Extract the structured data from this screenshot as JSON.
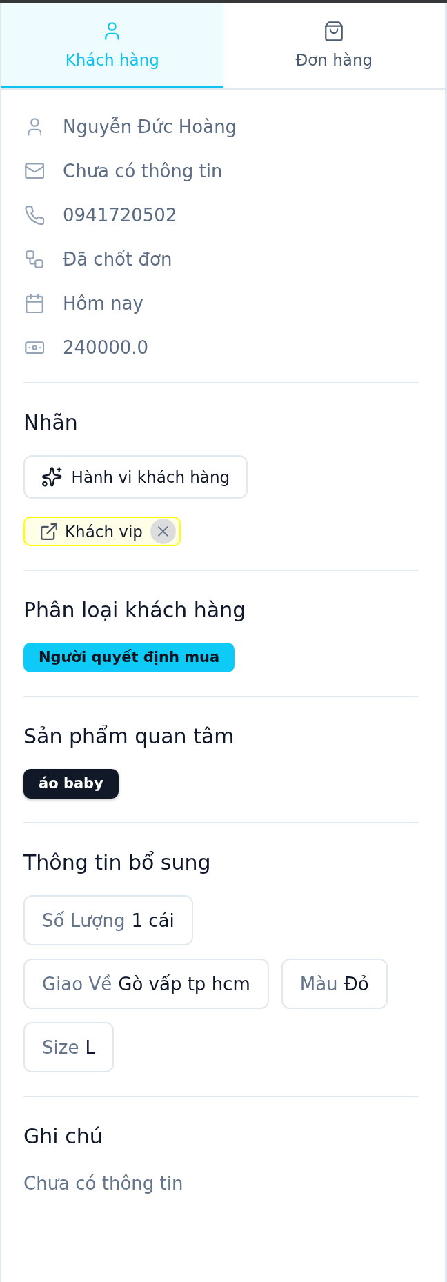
{
  "tabs": [
    {
      "kind": "customer",
      "label": "Khách hàng",
      "selected": true
    },
    {
      "kind": "order",
      "label": "Đơn hàng",
      "selected": false
    }
  ],
  "customer_info": [
    {
      "kind": "name",
      "value": "Nguyễn Đức Hoàng"
    },
    {
      "kind": "email",
      "value": "Chưa có thông tin"
    },
    {
      "kind": "phone",
      "value": "0941720502"
    },
    {
      "kind": "status",
      "value": "Đã chốt đơn"
    },
    {
      "kind": "date",
      "value": "Hôm nay"
    },
    {
      "kind": "amount",
      "value": "240000.0"
    }
  ],
  "labels": {
    "title": "Nhãn",
    "action_button": "Hành vi khách hàng",
    "tags": [
      {
        "text": "Khách vip",
        "color": "#ffff00"
      }
    ]
  },
  "classification": {
    "title": "Phân loại khách hàng",
    "badges": [
      "Người quyết định mua"
    ]
  },
  "interested_products": {
    "title": "Sản phẩm quan tâm",
    "badges": [
      "áo baby"
    ]
  },
  "additional_info": {
    "title": "Thông tin bổ sung",
    "items": [
      {
        "label": "Số Lượng",
        "value": "1 cái"
      },
      {
        "label": "Giao Về",
        "value": "Gò vấp tp hcm"
      },
      {
        "label": "Màu",
        "value": "Đỏ"
      },
      {
        "label": "Size",
        "value": "L"
      }
    ]
  },
  "notes": {
    "title": "Ghi chú",
    "text": "Chưa có thông tin"
  }
}
